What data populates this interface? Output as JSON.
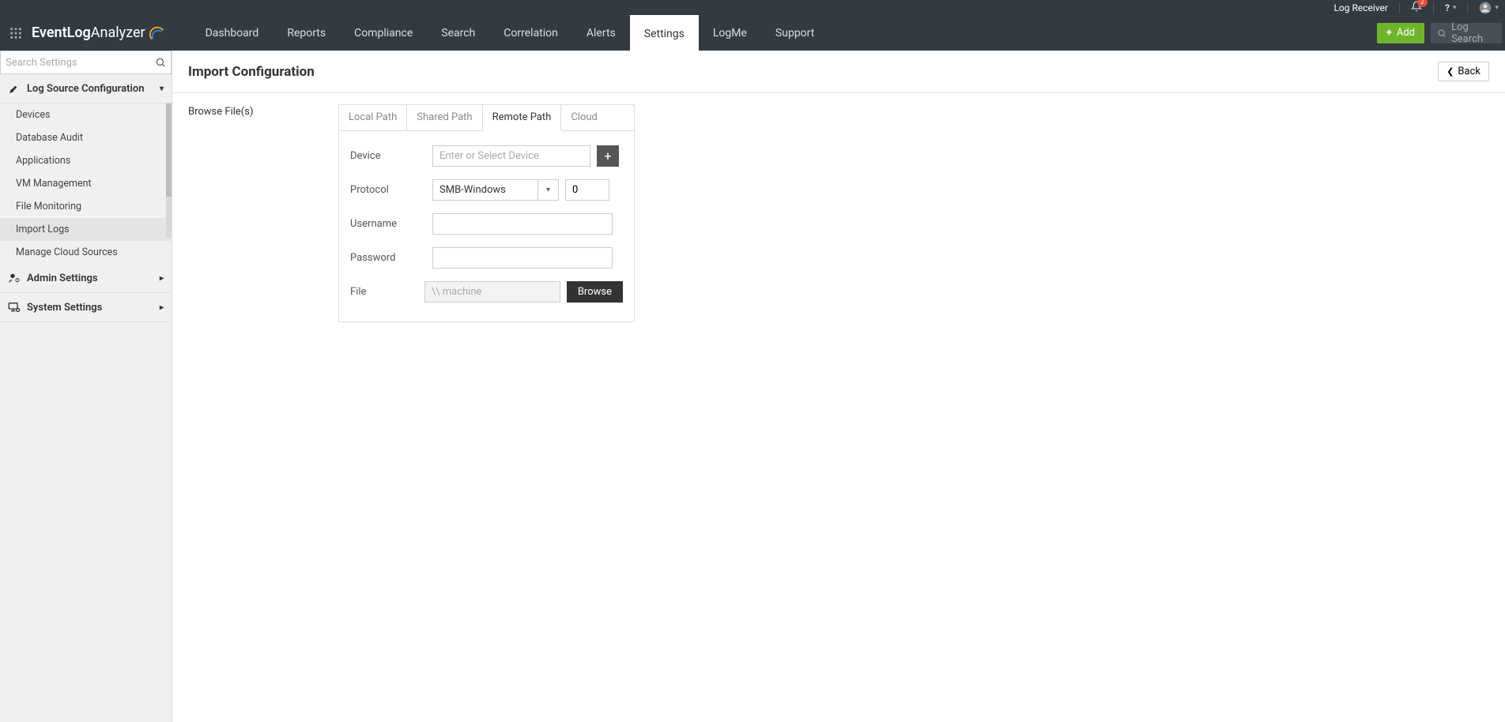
{
  "topbar": {
    "log_receiver": "Log Receiver",
    "notification_count": "2"
  },
  "brand": {
    "part1": "EventLog",
    "part2": " Analyzer"
  },
  "nav": {
    "items": [
      "Dashboard",
      "Reports",
      "Compliance",
      "Search",
      "Correlation",
      "Alerts",
      "Settings",
      "LogMe",
      "Support"
    ],
    "active": "Settings",
    "add_label": "Add",
    "log_search_placeholder": "Log Search"
  },
  "sidebar": {
    "search_placeholder": "Search Settings",
    "sections": [
      {
        "label": "Log Source Configuration",
        "icon": "tools",
        "expanded": true,
        "items": [
          "Devices",
          "Database Audit",
          "Applications",
          "VM Management",
          "File Monitoring",
          "Import Logs",
          "Manage Cloud Sources"
        ],
        "active": "Import Logs"
      },
      {
        "label": "Admin Settings",
        "icon": "user-cog",
        "expanded": false
      },
      {
        "label": "System Settings",
        "icon": "monitor-cog",
        "expanded": false
      }
    ]
  },
  "page": {
    "title": "Import Configuration",
    "back_label": "Back",
    "browse_files_label": "Browse File(s)"
  },
  "form": {
    "tabs": [
      "Local Path",
      "Shared Path",
      "Remote Path",
      "Cloud"
    ],
    "active_tab": "Remote Path",
    "device_label": "Device",
    "device_placeholder": "Enter or Select Device",
    "protocol_label": "Protocol",
    "protocol_value": "SMB-Windows",
    "port_value": "0",
    "username_label": "Username",
    "password_label": "Password",
    "file_label": "File",
    "file_placeholder": "\\\\ machine",
    "browse_label": "Browse"
  }
}
